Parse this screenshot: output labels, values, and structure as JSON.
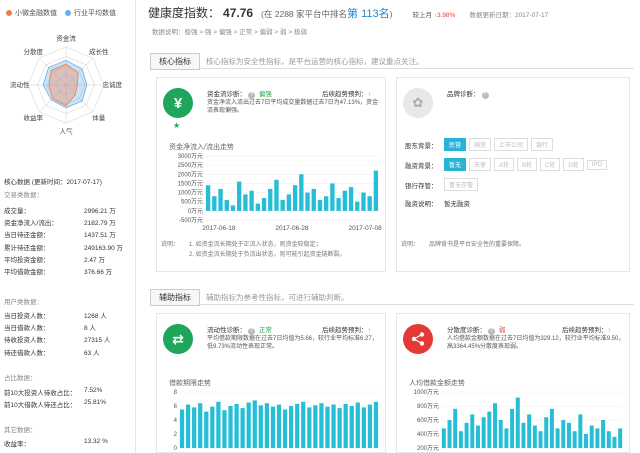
{
  "legend": {
    "mine": {
      "label": "小微金融数值",
      "color": "#f07d52"
    },
    "avg": {
      "label": "行业平均数值",
      "color": "#6aaee6"
    }
  },
  "radar": {
    "axes": [
      "资金流",
      "成长性",
      "忠诚度",
      "体量",
      "人气",
      "收益率",
      "流动性",
      "分散度"
    ],
    "mine": [
      0.55,
      0.45,
      0.3,
      0.35,
      0.55,
      0.5,
      0.45,
      0.55
    ],
    "avg": [
      0.65,
      0.6,
      0.55,
      0.6,
      0.6,
      0.55,
      0.6,
      0.65
    ]
  },
  "core_data": {
    "title": "核心数据",
    "date": "(更新时间：2017-07-17)",
    "trade_title": "交易类数据：",
    "trade": [
      {
        "label": "成交量：",
        "value": "2996.21 万"
      },
      {
        "label": "资金净流入/流出：",
        "value": "2182.79 万"
      },
      {
        "label": "当日待还金额：",
        "value": "1437.51 万"
      },
      {
        "label": "累计待还金额：",
        "value": "249163.90 万"
      },
      {
        "label": "平均投资金额：",
        "value": "2.47 万"
      },
      {
        "label": "平均借款金额：",
        "value": "376.66 万"
      }
    ],
    "user_title": "用户类数据：",
    "user": [
      {
        "label": "当日投资人数：",
        "value": "1268 人"
      },
      {
        "label": "当日借款人数：",
        "value": "8 人"
      },
      {
        "label": "待收投资人数：",
        "value": "27315 人"
      },
      {
        "label": "待还借款人数：",
        "value": "63 人"
      }
    ],
    "ratio_title": "占比数据：",
    "ratio": [
      {
        "label": "前10大投资人待收占比：",
        "value": "7.52%"
      },
      {
        "label": "前10大借款人待还占比：",
        "value": "25.81%"
      }
    ],
    "other_title": "其它数据：",
    "other": [
      {
        "label": "收益率：",
        "value": "13.32 %"
      }
    ]
  },
  "header": {
    "title": "健康度指数：",
    "score": "47.76",
    "rank_prefix": "(在 2288 家平台中排名",
    "rank_num": "第 113名",
    "rank_suffix": ")",
    "up_label": "较上月",
    "up_value": "↑3.98%",
    "update": "数据更新日期：2017-07-17"
  },
  "crumb": "数据说明：极强 > 强 > 偏强 > 正常 > 偏弱 > 弱 > 极弱",
  "core_strip": {
    "tab": "核心指标",
    "desc": "核心指标为安全性指标，是平台运营的核心指标，建议重点关注。"
  },
  "aux_strip": {
    "tab": "辅助指标",
    "desc": "辅助指标为参考性指标，可进行辅助判断。"
  },
  "cashflow": {
    "icon": "¥",
    "diag_label": "资金流诊断：",
    "diag_value": "偏强",
    "trend_label": "后续趋势预判：",
    "trend_value": "↑",
    "desc": "资金净流入流出过去7日平均成交量数据过去7日为47.13%，资金流表现偏强。",
    "chart_title": "资金净流入/流出走势",
    "note1": "1. 如资金流长期处于正流入状态，则资金较稳定；",
    "note2": "2. 如资金流长期处于负流出状态，则可能引起资金链断裂。",
    "note_prefix": "说明："
  },
  "brand": {
    "diag_label": "品牌诊断：",
    "bg_label": "股东背景：",
    "bg_tags": [
      "民营",
      "国资",
      "上市公司",
      "银行"
    ],
    "fin_label": "融资背景：",
    "fin_tags": [
      "暂无",
      "天使",
      "A轮",
      "B轮",
      "C轮",
      "D轮",
      "IPO"
    ],
    "bank_label": "银行存管：",
    "bank_tags": [
      "暂无存管"
    ],
    "fin_info_label": "融资说明：",
    "fin_info_value": "暂无融资",
    "note_prefix": "说明：",
    "note": "品牌背书是平台安全性的重要保障。"
  },
  "liquidity": {
    "icon": "⇄",
    "diag_label": "流动性诊断：",
    "diag_value": "正常",
    "trend_label": "后续趋势预判：",
    "trend_value": "↑",
    "desc": "平均借款期限数据在过去7日均值为5.66，较行业平均标准6.27，低9.73%流动性表现正常。",
    "chart_title": "借款期限走势"
  },
  "dispersion": {
    "icon": "share",
    "diag_label": "分散度诊断：",
    "diag_value": "弱",
    "trend_label": "后续趋势预判：",
    "trend_value": "↑",
    "desc": "人均借款金额数据在过去7日均值为329.12，较行业平均标准9.50，高3364.45%分散度表现弱。",
    "chart_title": "人均借款金额走势"
  },
  "chart_data": [
    {
      "type": "bar",
      "title": "资金净流入/流出走势",
      "ylim": [
        -500,
        3000
      ],
      "yticks": [
        "3000万元",
        "2500万元",
        "2000万元",
        "1500万元",
        "1000万元",
        "500万元",
        "0万元",
        "-500万元"
      ],
      "xticks": [
        "2017-06-18",
        "2017-06-28",
        "2017-07-08"
      ],
      "values": [
        1400,
        800,
        1200,
        600,
        300,
        1600,
        900,
        1100,
        400,
        700,
        1200,
        1700,
        600,
        900,
        1400,
        2000,
        1000,
        1200,
        600,
        800,
        1500,
        700,
        1100,
        1300,
        500,
        1000,
        800,
        2200
      ]
    },
    {
      "type": "bar",
      "title": "借款期限走势",
      "ylim": [
        0,
        8
      ],
      "yticks": [
        "8",
        "6",
        "4",
        "2",
        "0"
      ],
      "values": [
        5.5,
        6.2,
        5.8,
        6.4,
        5.2,
        5.9,
        6.6,
        5.4,
        6.0,
        6.3,
        5.7,
        6.5,
        6.8,
        6.1,
        6.4,
        5.9,
        6.2,
        5.5,
        6.0,
        6.3,
        6.6,
        5.8,
        6.1,
        6.4,
        5.9,
        6.2,
        5.7,
        6.3,
        6.0,
        6.5,
        5.8,
        6.2,
        6.6
      ]
    },
    {
      "type": "bar",
      "title": "人均借款金额走势",
      "ylim": [
        0,
        1000
      ],
      "yticks": [
        "1000万元",
        "800万元",
        "600万元",
        "400万元",
        "200万元"
      ],
      "values": [
        350,
        500,
        700,
        300,
        450,
        600,
        400,
        550,
        650,
        800,
        500,
        350,
        700,
        900,
        450,
        600,
        400,
        300,
        550,
        700,
        350,
        500,
        450,
        300,
        600,
        250,
        400,
        350,
        500,
        300,
        200,
        350
      ]
    }
  ]
}
